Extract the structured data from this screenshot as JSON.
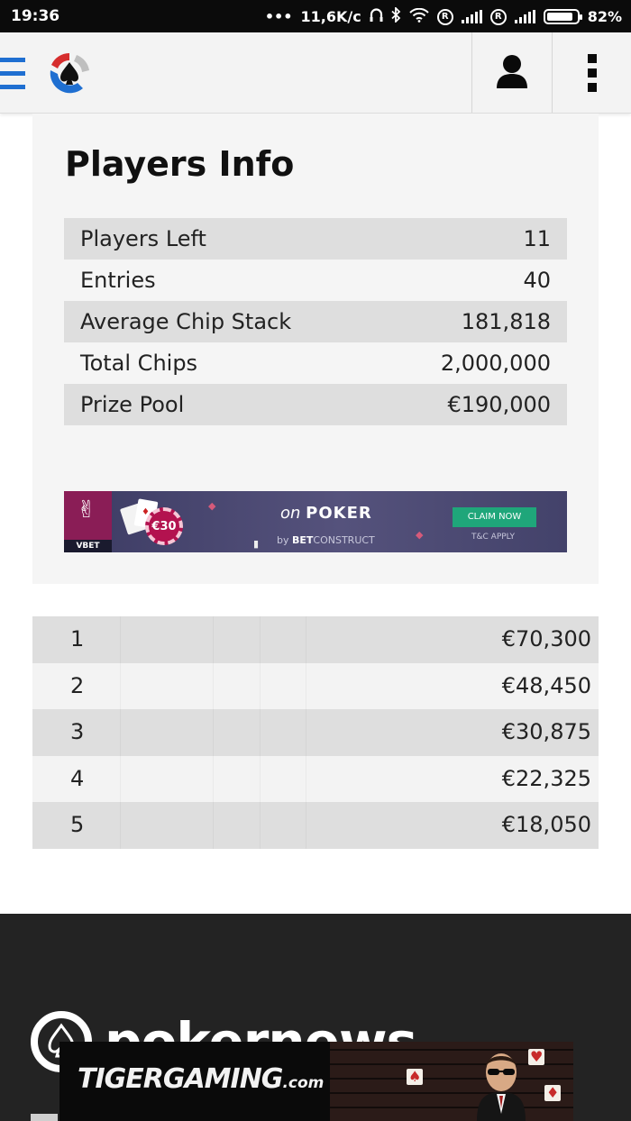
{
  "status_bar": {
    "time": "19:36",
    "dots": "•••",
    "net_speed": "11,6K/c",
    "roaming_1": "R",
    "roaming_2": "R",
    "battery": "82%"
  },
  "header": {
    "brand_colors": {
      "blue": "#1f6fd1",
      "red": "#d62d2d"
    },
    "icons": [
      "hamburger-menu-icon",
      "pokernews-logo-icon",
      "user-icon",
      "more-vertical-icon"
    ]
  },
  "players_info": {
    "title": "Players Info",
    "rows": [
      {
        "label": "Players Left",
        "value": "11"
      },
      {
        "label": "Entries",
        "value": "40"
      },
      {
        "label": "Average Chip Stack",
        "value": "181,818"
      },
      {
        "label": "Total Chips",
        "value": "2,000,000"
      },
      {
        "label": "Prize Pool",
        "value": "€190,000"
      }
    ]
  },
  "banner_ad": {
    "brand": "VBET",
    "chip_amount": "€30",
    "headline_prefix": "on",
    "headline_main": "POKER",
    "by_prefix": "by",
    "by_brand_bold": "BET",
    "by_brand_rest": "CONSTRUCT",
    "cta": "CLAIM NOW",
    "terms": "T&C APPLY"
  },
  "payouts": [
    {
      "place": "1",
      "prize": "€70,300"
    },
    {
      "place": "2",
      "prize": "€48,450"
    },
    {
      "place": "3",
      "prize": "€30,875"
    },
    {
      "place": "4",
      "prize": "€22,325"
    },
    {
      "place": "5",
      "prize": "€18,050"
    }
  ],
  "footer": {
    "logo_text": "pokernews"
  },
  "bottom_ad": {
    "brand": "TIGERGAMING",
    "suffix": ".com"
  }
}
